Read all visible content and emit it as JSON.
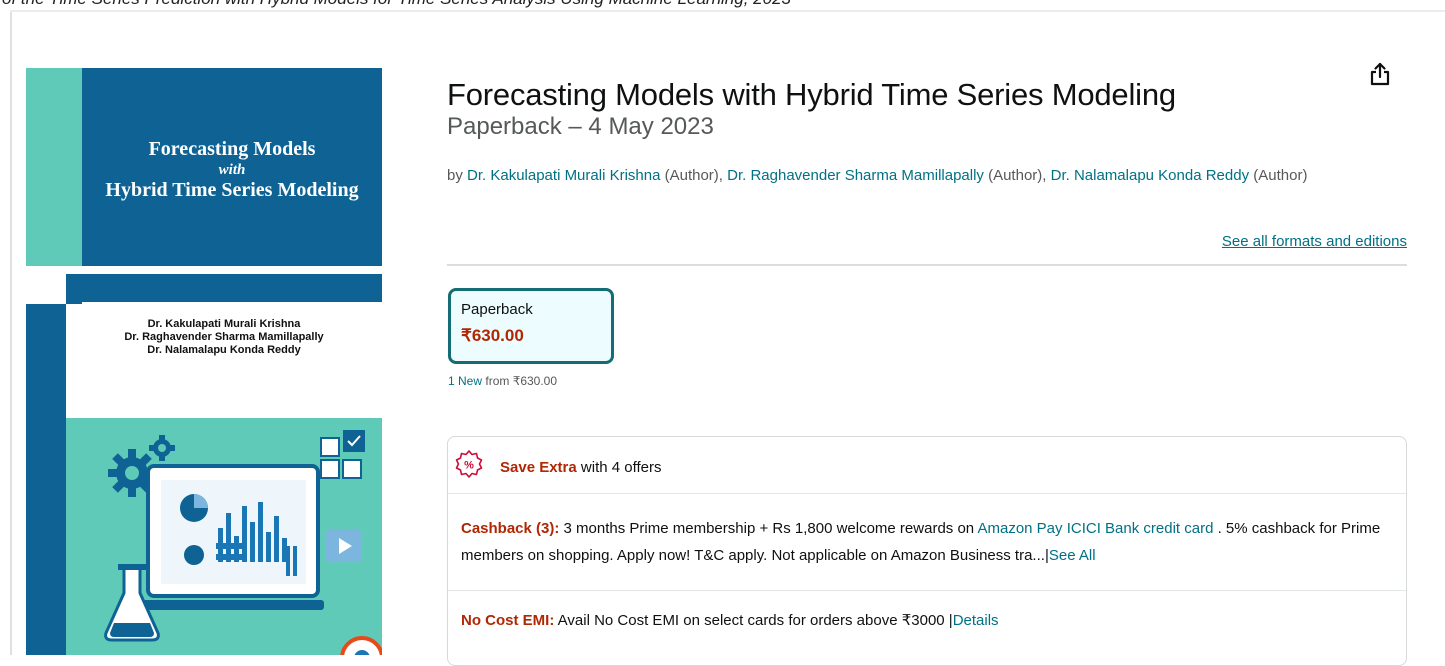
{
  "top_cut_text": "of the Time Series Prediction with Hybrid Models for Time Series Analysis Using Machine Learning, 2023",
  "cover": {
    "title_line1": "Forecasting Models",
    "title_line2": "with",
    "title_line3": "Hybrid Time Series Modeling",
    "authors": [
      "Dr. Kakulapati Murali Krishna",
      "Dr. Raghavender Sharma Mamillapally",
      "Dr. Nalamalapu Konda Reddy"
    ],
    "colors": {
      "blue": "#0e6394",
      "teal": "#5fcab8",
      "dark": "#075d8a"
    }
  },
  "product": {
    "title": "Forecasting Models with Hybrid Time Series Modeling",
    "format_date": "Paperback – 4 May 2023",
    "by_prefix": "by",
    "authors": [
      {
        "name": "Dr. Kakulapati Murali Krishna",
        "role": "(Author),"
      },
      {
        "name": "Dr. Raghavender Sharma Mamillapally",
        "role": "(Author),"
      },
      {
        "name": "Dr. Nalamalapu Konda Reddy",
        "role": "(Author)"
      }
    ],
    "see_all_formats": "See all formats and editions",
    "share_icon": "share-icon"
  },
  "format_option": {
    "name": "Paperback",
    "price": "₹630.00",
    "new_count": "1 New",
    "new_from": "from ₹630.00"
  },
  "offers": {
    "save_extra": "Save Extra",
    "with_offers": "with 4 offers",
    "cashback": {
      "label": "Cashback (3):",
      "text_before": "3 months Prime membership + Rs 1,800 welcome rewards on",
      "link": "Amazon Pay ICICI Bank credit card",
      "text_after": ". 5% cashback for Prime members on shopping. Apply now! T&C apply. Not applicable on Amazon Business tra...",
      "separator": "|",
      "action": "See All"
    },
    "emi": {
      "label": "No Cost EMI:",
      "text": "Avail No Cost EMI on select cards for orders above ₹3000",
      "separator": "|",
      "action": "Details"
    }
  }
}
